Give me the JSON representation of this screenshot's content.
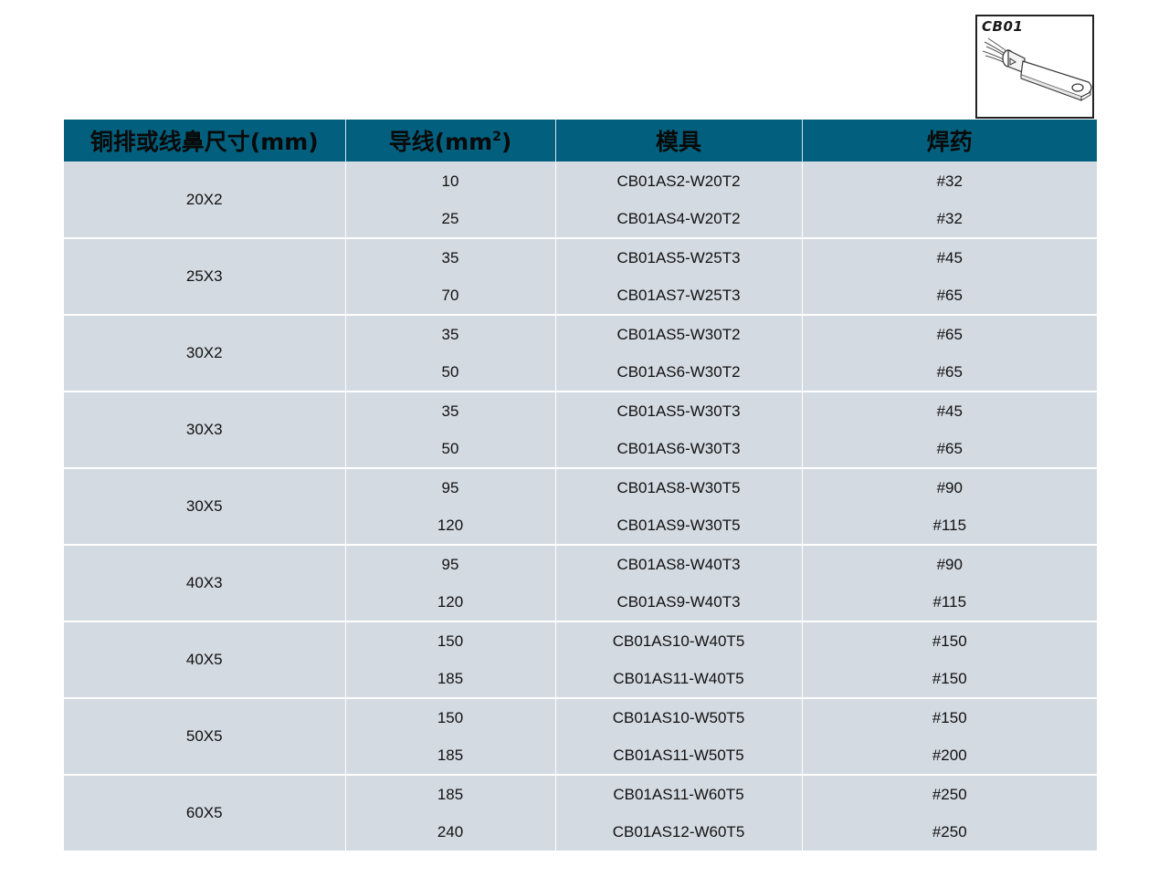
{
  "product": {
    "code": "CB01"
  },
  "table": {
    "headers": [
      {
        "text": "铜排或线鼻尺寸(mm)",
        "sup": ""
      },
      {
        "text": "导线(mm",
        "sup": "2",
        "suffix": ")"
      },
      {
        "text": "模具",
        "sup": ""
      },
      {
        "text": "焊药",
        "sup": ""
      }
    ],
    "groups": [
      {
        "size": "20X2",
        "rows": [
          {
            "wire": "10",
            "mold": "CB01AS2-W20T2",
            "powder": "#32"
          },
          {
            "wire": "25",
            "mold": "CB01AS4-W20T2",
            "powder": "#32"
          }
        ]
      },
      {
        "size": "25X3",
        "rows": [
          {
            "wire": "35",
            "mold": "CB01AS5-W25T3",
            "powder": "#45"
          },
          {
            "wire": "70",
            "mold": "CB01AS7-W25T3",
            "powder": "#65"
          }
        ]
      },
      {
        "size": "30X2",
        "rows": [
          {
            "wire": "35",
            "mold": "CB01AS5-W30T2",
            "powder": "#65"
          },
          {
            "wire": "50",
            "mold": "CB01AS6-W30T2",
            "powder": "#65"
          }
        ]
      },
      {
        "size": "30X3",
        "rows": [
          {
            "wire": "35",
            "mold": "CB01AS5-W30T3",
            "powder": "#45"
          },
          {
            "wire": "50",
            "mold": "CB01AS6-W30T3",
            "powder": "#65"
          }
        ]
      },
      {
        "size": "30X5",
        "rows": [
          {
            "wire": "95",
            "mold": "CB01AS8-W30T5",
            "powder": "#90"
          },
          {
            "wire": "120",
            "mold": "CB01AS9-W30T5",
            "powder": "#115"
          }
        ]
      },
      {
        "size": "40X3",
        "rows": [
          {
            "wire": "95",
            "mold": "CB01AS8-W40T3",
            "powder": "#90"
          },
          {
            "wire": "120",
            "mold": "CB01AS9-W40T3",
            "powder": "#115"
          }
        ]
      },
      {
        "size": "40X5",
        "rows": [
          {
            "wire": "150",
            "mold": "CB01AS10-W40T5",
            "powder": "#150"
          },
          {
            "wire": "185",
            "mold": "CB01AS11-W40T5",
            "powder": "#150"
          }
        ]
      },
      {
        "size": "50X5",
        "rows": [
          {
            "wire": "150",
            "mold": "CB01AS10-W50T5",
            "powder": "#150"
          },
          {
            "wire": "185",
            "mold": "CB01AS11-W50T5",
            "powder": "#200"
          }
        ]
      },
      {
        "size": "60X5",
        "rows": [
          {
            "wire": "185",
            "mold": "CB01AS11-W60T5",
            "powder": "#250"
          },
          {
            "wire": "240",
            "mold": "CB01AS12-W60T5",
            "powder": "#250"
          }
        ]
      }
    ]
  },
  "colors": {
    "header_bg": "#02607e",
    "row_bg": "#d4dae2",
    "divider": "#ffffff"
  }
}
